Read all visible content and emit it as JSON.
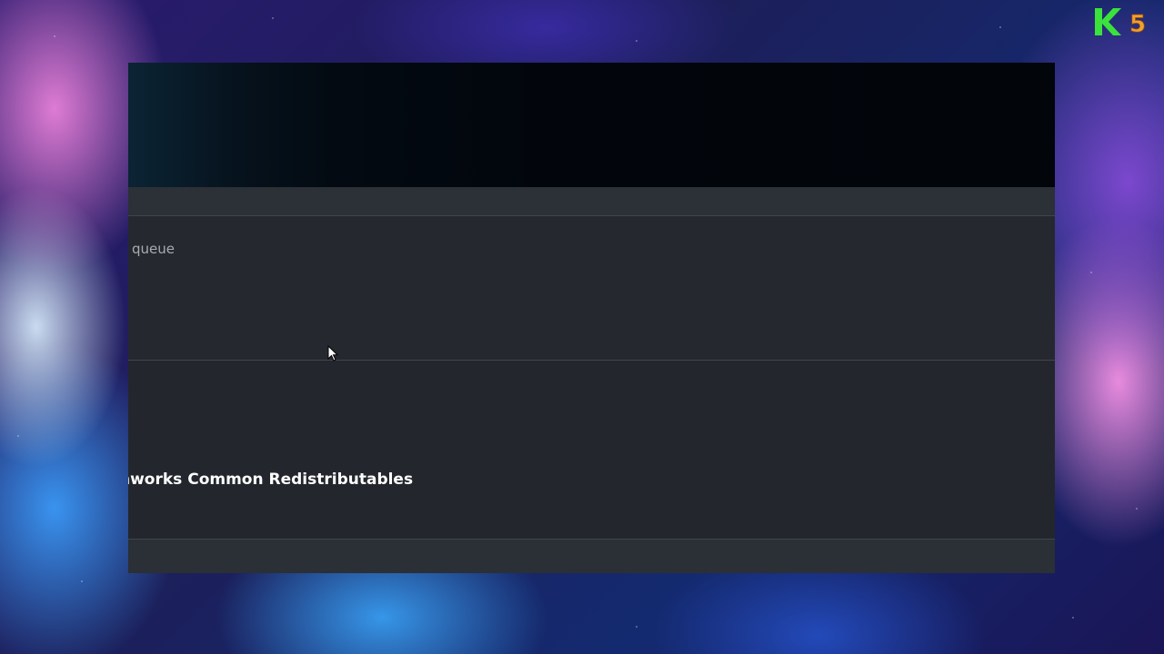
{
  "window": {
    "queue_label": "e queue",
    "app_title": "nworks Common Redistributables"
  },
  "overlay_logo": {
    "letter": "K",
    "number": "5",
    "letter_color": "#3be23b",
    "number_color": "#f0a030"
  },
  "colors": {
    "window_bg": "#24282f",
    "header_bg": "#02050a",
    "divider": "#41464e"
  },
  "icons": [
    "mouse-cursor-icon"
  ]
}
